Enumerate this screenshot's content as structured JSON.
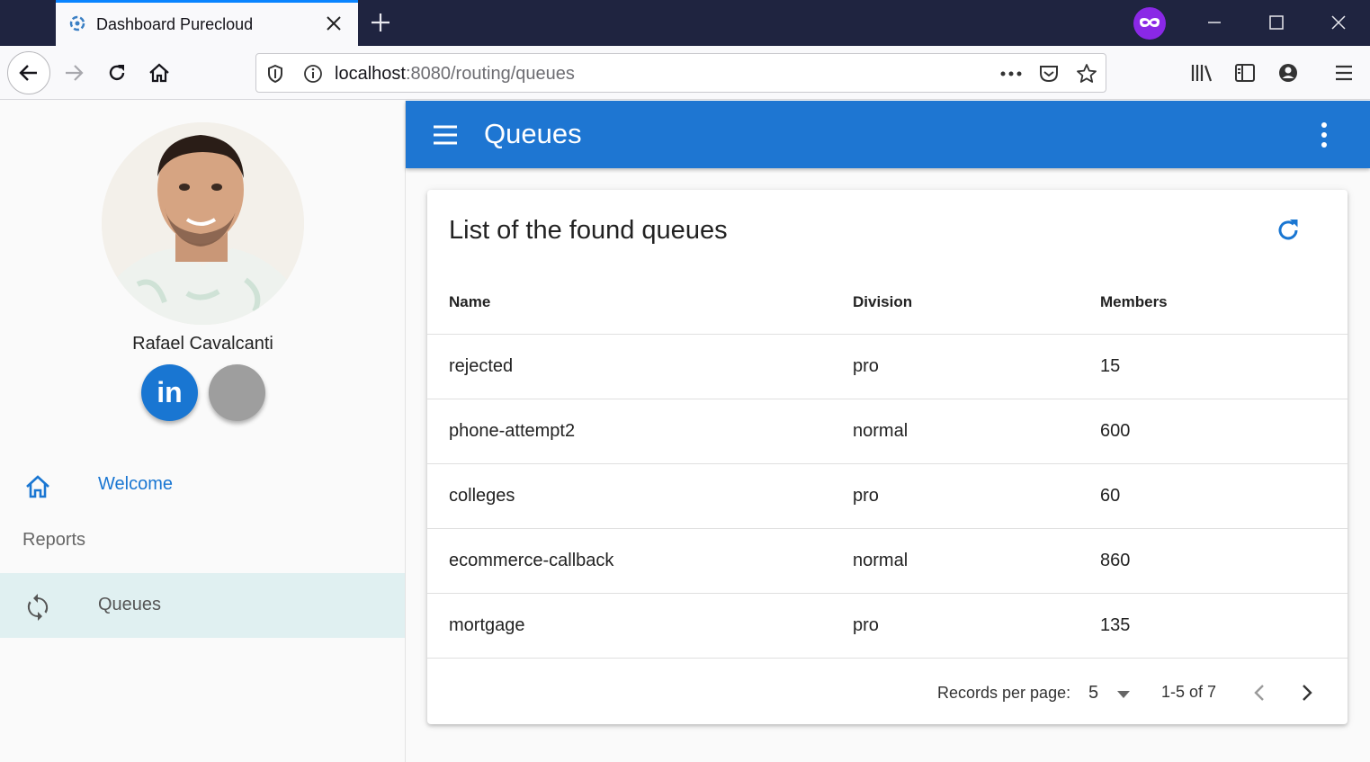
{
  "browser": {
    "tab_title": "Dashboard Purecloud",
    "url_host": "localhost",
    "url_path": ":8080/routing/queues"
  },
  "sidebar": {
    "profile_name": "Rafael Cavalcanti",
    "linkedin_label": "in",
    "nav": {
      "welcome": "Welcome",
      "reports_header": "Reports",
      "queues": "Queues"
    }
  },
  "appbar": {
    "title": "Queues"
  },
  "card": {
    "title": "List of the found queues",
    "columns": [
      "Name",
      "Division",
      "Members"
    ],
    "rows": [
      {
        "name": "rejected",
        "division": "pro",
        "members": "15"
      },
      {
        "name": "phone-attempt2",
        "division": "normal",
        "members": "600"
      },
      {
        "name": "colleges",
        "division": "pro",
        "members": "60"
      },
      {
        "name": "ecommerce-callback",
        "division": "normal",
        "members": "860"
      },
      {
        "name": "mortgage",
        "division": "pro",
        "members": "135"
      }
    ],
    "footer": {
      "records_per_page_label": "Records per page:",
      "records_per_page_value": "5",
      "range": "1-5 of 7"
    }
  },
  "colors": {
    "primary": "#1e76d2",
    "selected_nav_bg": "#e0f0f1",
    "titlebar": "#1f2440"
  },
  "icons": [
    "purecloud-favicon",
    "close-icon",
    "plus-icon",
    "private-browsing-icon",
    "minimize-icon",
    "maximize-icon",
    "back-icon",
    "forward-icon",
    "reload-icon",
    "home-icon",
    "shield-icon",
    "info-icon",
    "more-horizontal-icon",
    "pocket-icon",
    "star-icon",
    "library-icon",
    "sidebar-toggle-icon",
    "account-icon",
    "hamburger-icon",
    "github-icon",
    "sync-icon",
    "more-vertical-icon",
    "refresh-icon",
    "caret-down-icon",
    "chevron-left-icon",
    "chevron-right-icon"
  ]
}
